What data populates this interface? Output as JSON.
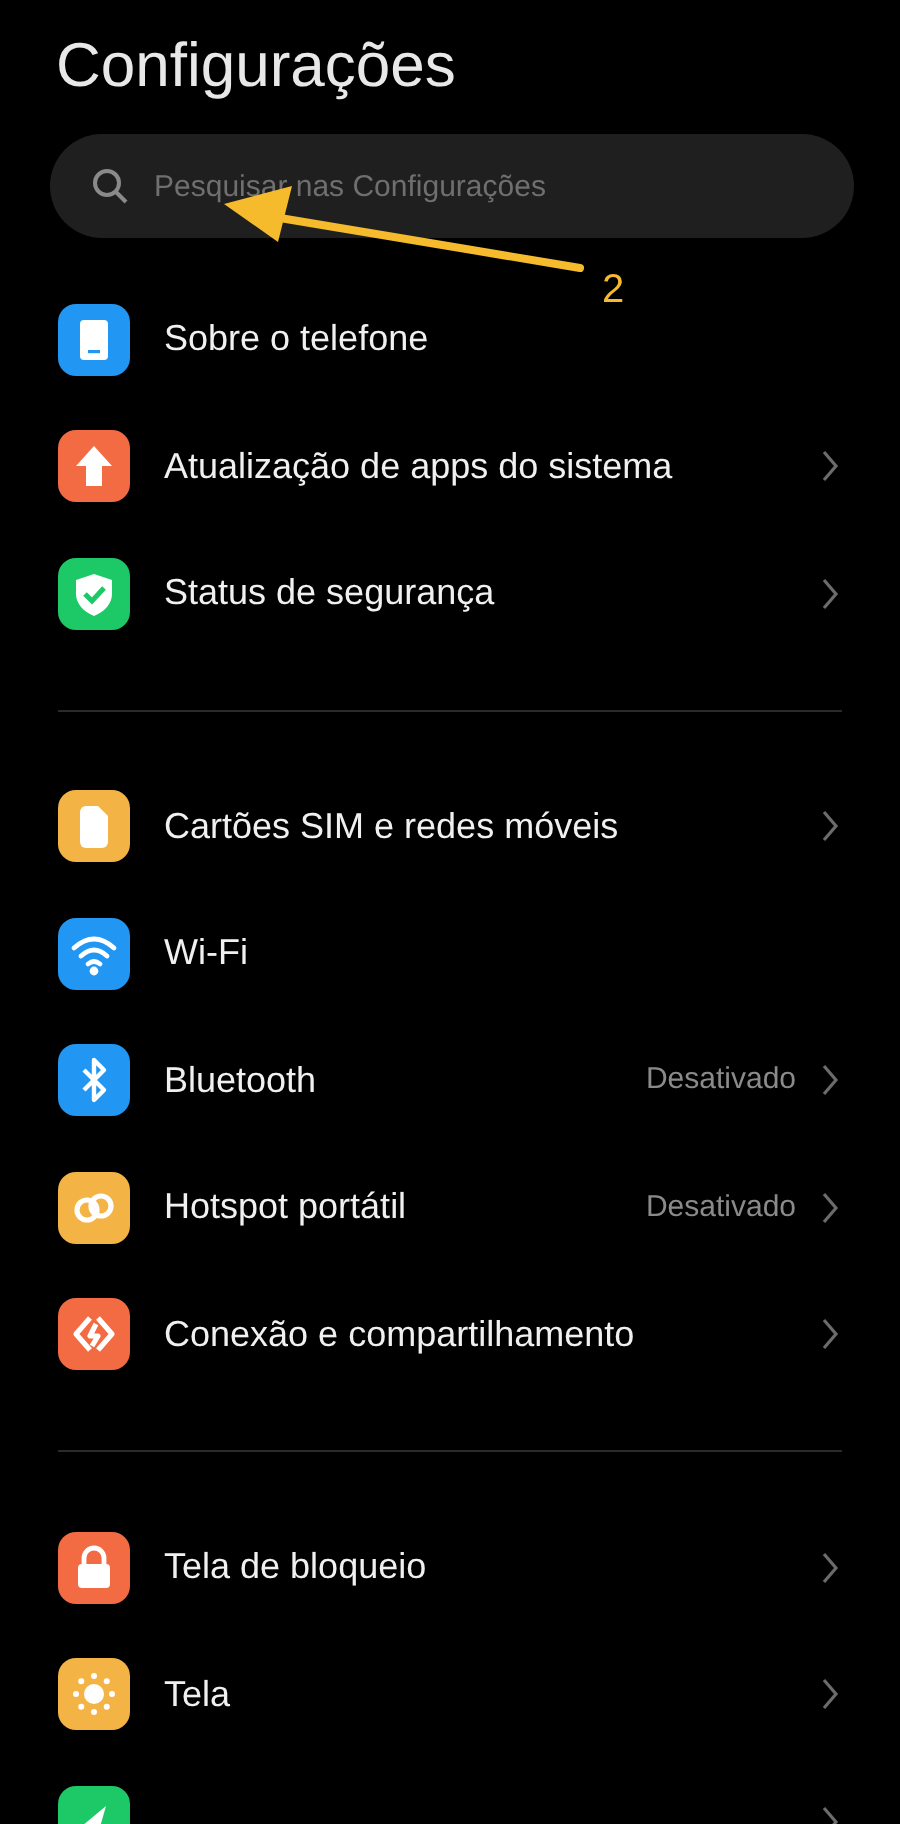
{
  "title": "Configurações",
  "search": {
    "placeholder": "Pesquisar nas Configurações"
  },
  "sections": [
    {
      "items": [
        {
          "label": "Sobre o telefone",
          "color": "#2196f3",
          "chevron": false
        },
        {
          "label": "Atualização de apps do sistema",
          "color": "#f26b43",
          "chevron": true
        },
        {
          "label": "Status de segurança",
          "color": "#1dc866",
          "chevron": true
        }
      ]
    },
    {
      "items": [
        {
          "label": "Cartões SIM e redes móveis",
          "color": "#f4b445",
          "chevron": true
        },
        {
          "label": "Wi-Fi",
          "color": "#2196f3",
          "chevron": false
        },
        {
          "label": "Bluetooth",
          "value": "Desativado",
          "color": "#2196f3",
          "chevron": true
        },
        {
          "label": "Hotspot portátil",
          "value": "Desativado",
          "color": "#f4b445",
          "chevron": true
        },
        {
          "label": "Conexão e compartilhamento",
          "color": "#f26b43",
          "chevron": true
        }
      ]
    },
    {
      "items": [
        {
          "label": "Tela de bloqueio",
          "color": "#f26b43",
          "chevron": true
        },
        {
          "label": "Tela",
          "color": "#f4b445",
          "chevron": true
        },
        {
          "color": "#1dc866",
          "chevron": true
        }
      ]
    }
  ],
  "annotation": {
    "label": "2"
  }
}
